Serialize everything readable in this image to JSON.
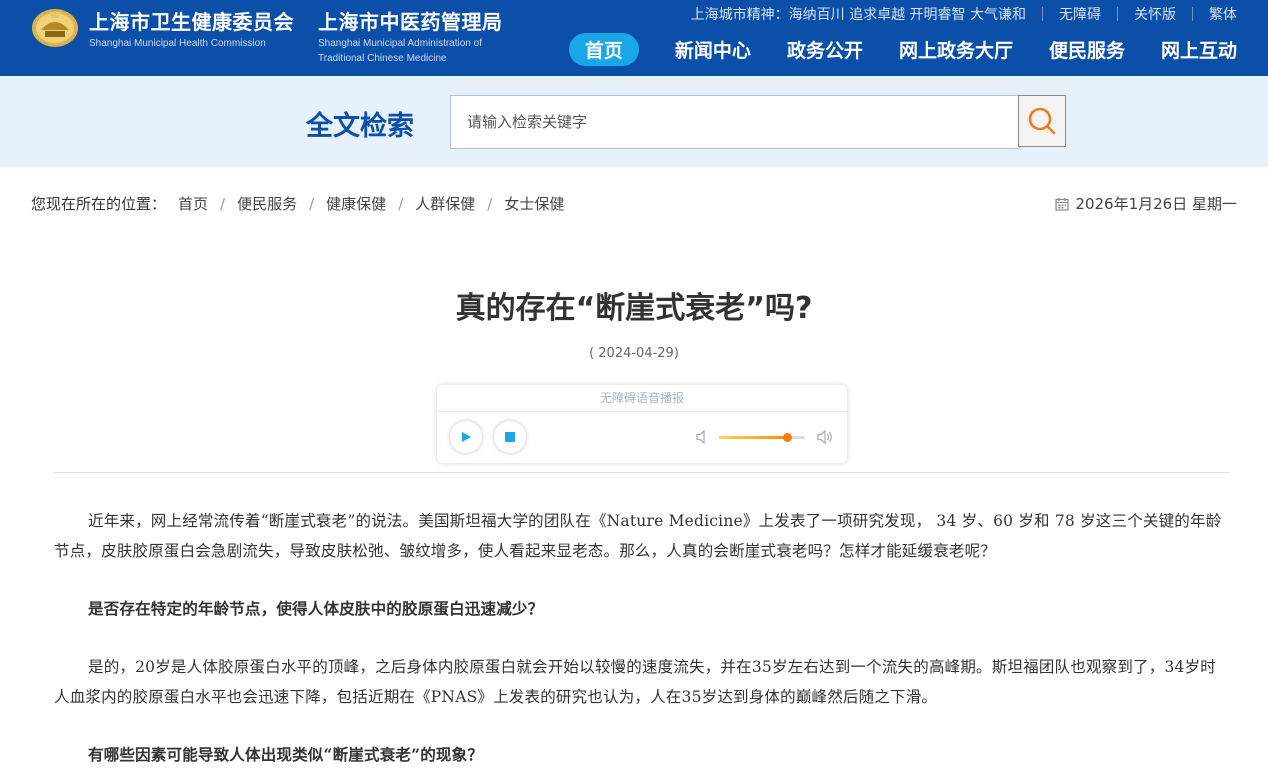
{
  "header": {
    "org1_cn": "上海市卫生健康委员会",
    "org1_en": "Shanghai Municipal Health Commission",
    "org2_cn": "上海市中医药管理局",
    "org2_en_line1": "Shanghai Municipal Administration of",
    "org2_en_line2": "Traditional Chinese Medicine",
    "spirit": "上海城市精神：海纳百川 追求卓越 开明睿智 大气谦和",
    "links": [
      "无障碍",
      "关怀版",
      "繁体"
    ],
    "nav": [
      "首页",
      "新闻中心",
      "政务公开",
      "网上政务大厅",
      "便民服务",
      "网上互动"
    ],
    "colors": {
      "brand": "#0b4fa8",
      "nav_active": "#1aa7e8"
    }
  },
  "search": {
    "title": "全文检索",
    "placeholder": "请输入检索关键字",
    "button_icon": "search-icon"
  },
  "breadcrumb": {
    "label": "您现在所在的位置：",
    "items": [
      "首页",
      "便民服务",
      "健康保健",
      "人群保健",
      "女士保健"
    ],
    "date": "2026年1月26日 星期一"
  },
  "article": {
    "title": "真的存在“断崖式衰老”吗?",
    "date": "( 2024-04-29)",
    "player": {
      "label": "无障碍语音播报",
      "volume": 0.8
    },
    "paragraphs": [
      "近年来，网上经常流传着“断崖式衰老”的说法。美国斯坦福大学的团队在《Nature Medicine》上发表了一项研究发现， 34 岁、60 岁和 78 岁这三个关键的年龄节点，皮肤胶原蛋白会急剧流失，导致皮肤松弛、皱纹增多，使人看起来显老态。那么，人真的会断崖式衰老吗？怎样才能延缓衰老呢？",
      "是否存在特定的年龄节点，使得人体皮肤中的胶原蛋白迅速减少？",
      "是的，20岁是人体胶原蛋白水平的顶峰，之后身体内胶原蛋白就会开始以较慢的速度流失，并在35岁左右达到一个流失的高峰期。斯坦福团队也观察到了，34岁时人血浆内的胶原蛋白水平也会迅速下降，包括近期在《PNAS》上发表的研究也认为，人在35岁达到身体的巅峰然后随之下滑。",
      "有哪些因素可能导致人体出现类似“断崖式衰老”的现象？"
    ]
  }
}
